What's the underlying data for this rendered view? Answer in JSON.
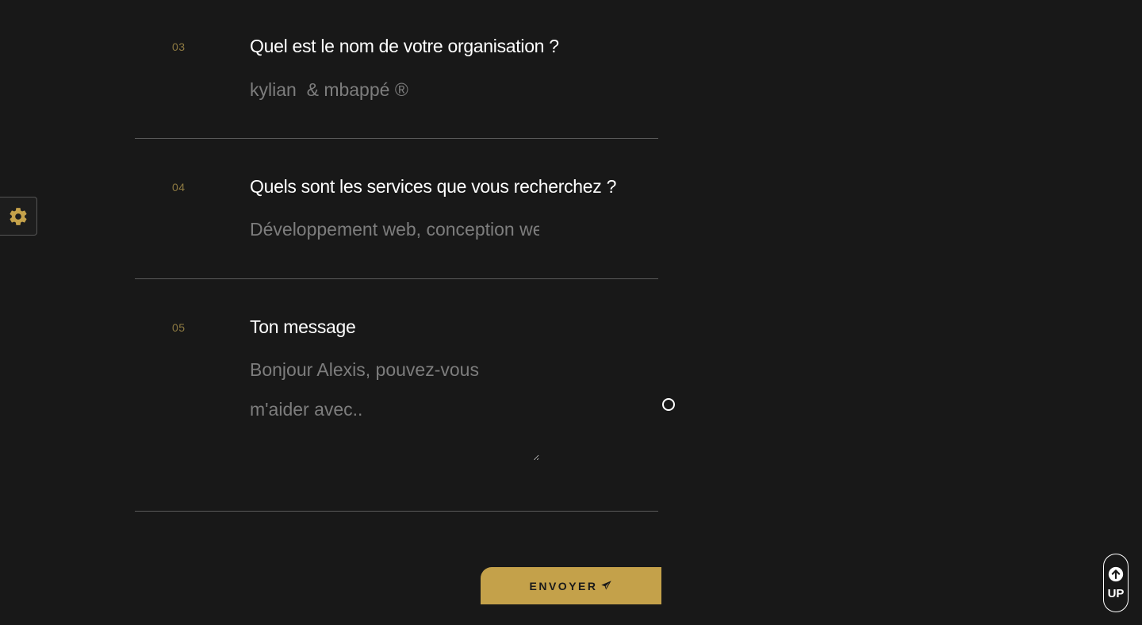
{
  "form": {
    "sections": [
      {
        "number": "03",
        "question": "Quel est le nom de votre organisation ?",
        "placeholder": "kylian  & mbappé ®"
      },
      {
        "number": "04",
        "question": "Quels sont les services que vous recherchez ?",
        "placeholder": "Développement web, conception web"
      },
      {
        "number": "05",
        "question": "Ton message",
        "placeholder": "Bonjour Alexis, pouvez-vous m'aider avec.."
      }
    ],
    "submit_label": "ENVOYER"
  },
  "floating": {
    "settings_icon": "gear-icon",
    "up_label": "UP",
    "up_icon": "arrow-up-circle-icon"
  },
  "colors": {
    "background": "#181818",
    "accent": "#c4a14a",
    "number": "#8e7a42",
    "placeholder": "#7d7d7d"
  }
}
